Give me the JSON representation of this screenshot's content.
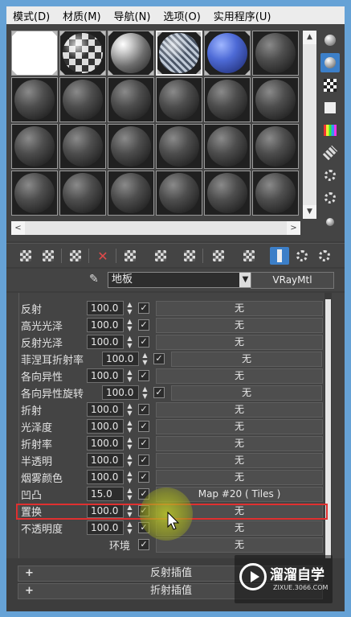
{
  "menubar": {
    "items": [
      "模式(D)",
      "材质(M)",
      "导航(N)",
      "选项(O)",
      "实用程序(U)"
    ]
  },
  "sample_slots": {
    "rows": 4,
    "columns": 6,
    "first_row_types": [
      "white",
      "checker",
      "chrome",
      "grid",
      "blue",
      "default"
    ],
    "active_slot": 3
  },
  "material": {
    "name": "地板",
    "type": "VRayMtl"
  },
  "maps": [
    {
      "label": "反射",
      "value": "100.0",
      "checked": true,
      "map": "无"
    },
    {
      "label": "高光光泽",
      "value": "100.0",
      "checked": true,
      "map": "无"
    },
    {
      "label": "反射光泽",
      "value": "100.0",
      "checked": true,
      "map": "无"
    },
    {
      "label": "菲涅耳折射率",
      "value": "100.0",
      "checked": true,
      "map": "无"
    },
    {
      "label": "各向异性",
      "value": "100.0",
      "checked": true,
      "map": "无"
    },
    {
      "label": "各向异性旋转",
      "value": "100.0",
      "checked": true,
      "map": "无"
    },
    {
      "label": "折射",
      "value": "100.0",
      "checked": true,
      "map": "无"
    },
    {
      "label": "光泽度",
      "value": "100.0",
      "checked": true,
      "map": "无"
    },
    {
      "label": "折射率",
      "value": "100.0",
      "checked": true,
      "map": "无"
    },
    {
      "label": "半透明",
      "value": "100.0",
      "checked": true,
      "map": "无"
    },
    {
      "label": "烟雾颜色",
      "value": "100.0",
      "checked": true,
      "map": "无"
    },
    {
      "label": "凹凸",
      "value": "15.0",
      "checked": true,
      "map": "Map #20  ( Tiles )"
    },
    {
      "label": "置换",
      "value": "100.0",
      "checked": true,
      "map": "无"
    },
    {
      "label": "不透明度",
      "value": "100.0",
      "checked": true,
      "map": "无"
    },
    {
      "label": "环境",
      "value": "",
      "checked": true,
      "map": "无"
    }
  ],
  "check_mark": "✓",
  "rollouts": [
    {
      "sign": "+",
      "title": "反射插值"
    },
    {
      "sign": "+",
      "title": "折射插值"
    }
  ],
  "watermark": {
    "title": "溜溜自学",
    "subtitle": "ZIXUE.3066.COM"
  },
  "colors": {
    "frame": "#66a2d6",
    "active_tool": "#3c7fc8",
    "highlight": "#e03030"
  }
}
